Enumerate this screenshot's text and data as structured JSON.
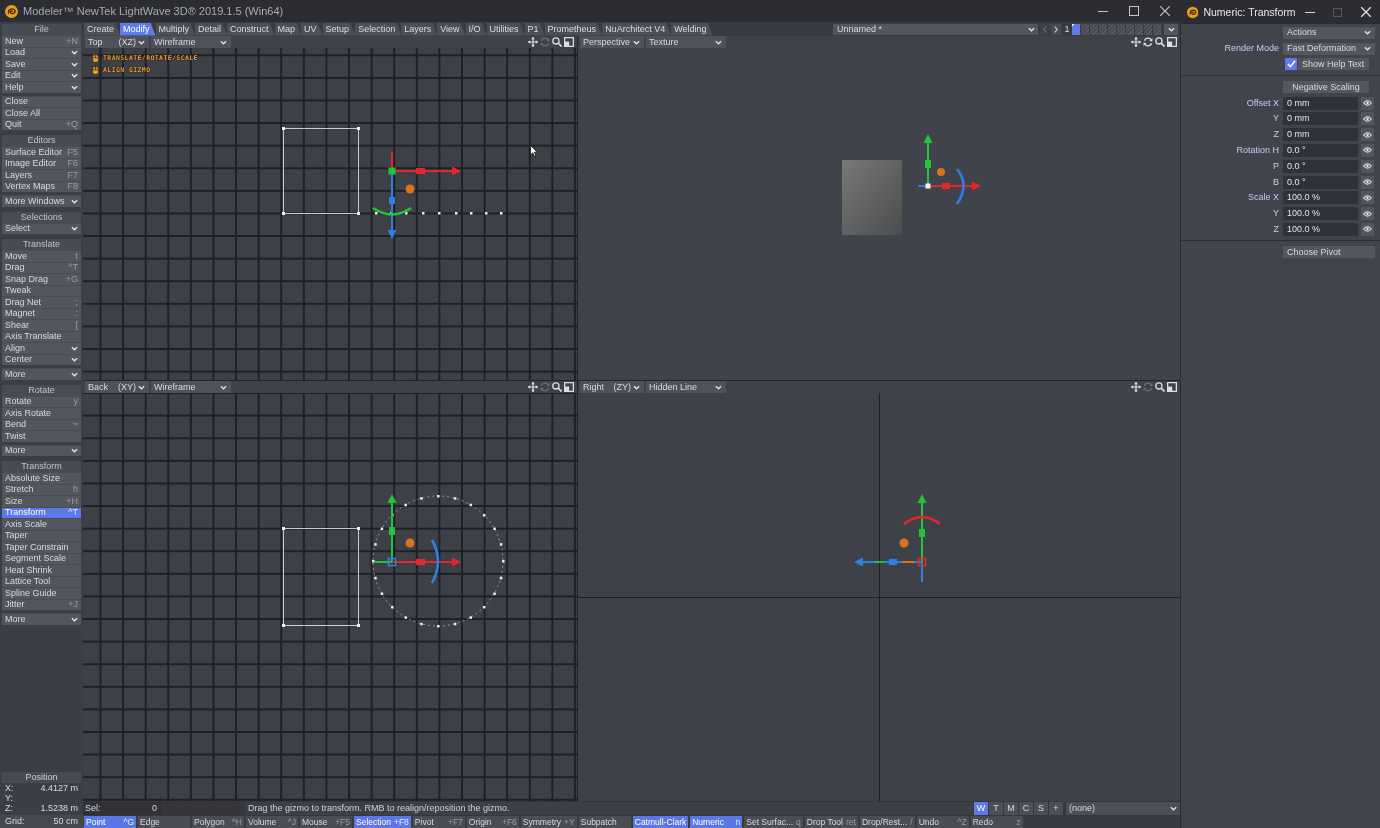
{
  "window": {
    "title": "Modeler™ NewTek LightWave 3D® 2019.1.5 (Win64)"
  },
  "sidebar": [
    {
      "title": "File",
      "items": [
        {
          "label": "New",
          "shortcut": "+N",
          "kind": "button",
          "selected": false
        },
        {
          "label": "Load",
          "kind": "menu",
          "selected": false
        },
        {
          "label": "Save",
          "kind": "menu",
          "selected": false
        },
        {
          "label": "Edit",
          "kind": "menu",
          "selected": false
        },
        {
          "label": "Help",
          "kind": "menu",
          "selected": false
        }
      ]
    },
    {
      "items": [
        {
          "label": "Close",
          "kind": "button",
          "selected": false
        },
        {
          "label": "Close All",
          "kind": "button",
          "selected": false
        },
        {
          "label": "Quit",
          "shortcut": "+Q",
          "kind": "button",
          "selected": false
        }
      ]
    },
    {
      "title": "Editors",
      "items": [
        {
          "label": "Surface Editor",
          "shortcut": "F5",
          "kind": "button",
          "selected": false
        },
        {
          "label": "Image Editor",
          "shortcut": "F6",
          "kind": "button",
          "selected": false
        },
        {
          "label": "Layers",
          "shortcut": "F7",
          "kind": "button",
          "selected": false
        },
        {
          "label": "Vertex Maps",
          "shortcut": "F8",
          "kind": "button",
          "selected": false
        }
      ]
    },
    {
      "items": [
        {
          "label": "More Windows",
          "kind": "menu",
          "selected": false
        }
      ]
    },
    {
      "title": "Selections",
      "items": [
        {
          "label": "Select",
          "kind": "menu",
          "selected": false
        }
      ]
    },
    {
      "title": "Translate",
      "items": [
        {
          "label": "Move",
          "shortcut": "t",
          "kind": "button",
          "selected": false
        },
        {
          "label": "Drag",
          "shortcut": "^T",
          "kind": "button",
          "selected": false
        },
        {
          "label": "Snap Drag",
          "shortcut": "+G",
          "kind": "button",
          "selected": false
        },
        {
          "label": "Tweak",
          "kind": "button",
          "selected": false
        },
        {
          "label": "Drag Net",
          "shortcut": ";",
          "kind": "button",
          "selected": false
        },
        {
          "label": "Magnet",
          "shortcut": ":",
          "kind": "button",
          "selected": false
        },
        {
          "label": "Shear",
          "shortcut": "[",
          "kind": "button",
          "selected": false
        },
        {
          "label": "Axis Translate",
          "kind": "button",
          "selected": false
        },
        {
          "label": "Align",
          "kind": "menu",
          "selected": false
        },
        {
          "label": "Center",
          "kind": "menu",
          "selected": false
        }
      ]
    },
    {
      "items": [
        {
          "label": "More",
          "kind": "menu",
          "selected": false
        }
      ]
    },
    {
      "title": "Rotate",
      "items": [
        {
          "label": "Rotate",
          "shortcut": "y",
          "kind": "button",
          "selected": false
        },
        {
          "label": "Axis Rotate",
          "kind": "button",
          "selected": false
        },
        {
          "label": "Bend",
          "shortcut": "~",
          "kind": "button",
          "selected": false
        },
        {
          "label": "Twist",
          "kind": "button",
          "selected": false
        }
      ]
    },
    {
      "items": [
        {
          "label": "More",
          "kind": "menu",
          "selected": false
        }
      ]
    },
    {
      "title": "Transform",
      "items": [
        {
          "label": "Absolute Size",
          "kind": "button",
          "selected": false
        },
        {
          "label": "Stretch",
          "shortcut": "h",
          "kind": "button",
          "selected": false
        },
        {
          "label": "Size",
          "shortcut": "+H",
          "kind": "button",
          "selected": false
        },
        {
          "label": "Transform",
          "shortcut": "^T",
          "kind": "button",
          "selected": true
        },
        {
          "label": "Axis Scale",
          "kind": "button",
          "selected": false
        },
        {
          "label": "Taper",
          "kind": "button",
          "selected": false
        },
        {
          "label": "Taper Constrain",
          "kind": "button",
          "selected": false
        },
        {
          "label": "Segment Scale",
          "kind": "button",
          "selected": false
        },
        {
          "label": "Heat Shrink",
          "kind": "button",
          "selected": false
        },
        {
          "label": "Lattice Tool",
          "kind": "button",
          "selected": false
        },
        {
          "label": "Spline Guide",
          "kind": "button",
          "selected": false
        },
        {
          "label": "Jitter",
          "shortcut": "+J",
          "kind": "button",
          "selected": false
        }
      ]
    },
    {
      "items": [
        {
          "label": "More",
          "kind": "menu",
          "selected": false
        }
      ]
    }
  ],
  "position": {
    "title": "Position",
    "rows": [
      {
        "axis": "X:",
        "value": "4.4127 m"
      },
      {
        "axis": "Y:"
      },
      {
        "axis": "Z:",
        "value": "1.5238 m"
      }
    ]
  },
  "grid": {
    "label": "Grid:",
    "value": "50 cm"
  },
  "tabs": [
    {
      "label": "Create",
      "selected": false
    },
    {
      "label": "Modify",
      "selected": true
    },
    {
      "label": "Multiply",
      "selected": false
    },
    {
      "label": "Detail",
      "selected": false
    },
    {
      "label": "Construct",
      "selected": false
    },
    {
      "label": "Map",
      "selected": false
    },
    {
      "label": "UV",
      "selected": false
    },
    {
      "label": "Setup",
      "selected": false
    },
    {
      "label": "Selection",
      "selected": false
    },
    {
      "label": "Layers",
      "selected": false
    },
    {
      "label": "View",
      "selected": false
    },
    {
      "label": "I/O",
      "selected": false
    },
    {
      "label": "Utilities",
      "selected": false
    },
    {
      "label": "P1",
      "selected": false
    },
    {
      "label": "Prometheus",
      "selected": false
    },
    {
      "label": "NuArchitect V4",
      "selected": false
    },
    {
      "label": "Welding",
      "selected": false
    }
  ],
  "scene": {
    "name": "Unnamed *",
    "bank": "1",
    "layers": [
      {
        "selected": true
      },
      {
        "selected": false
      },
      {
        "selected": false
      },
      {
        "selected": false
      },
      {
        "selected": false
      },
      {
        "selected": false
      },
      {
        "selected": false
      },
      {
        "selected": false
      },
      {
        "selected": false
      },
      {
        "selected": false
      }
    ]
  },
  "viewports": [
    {
      "kind": "top",
      "view": "Top",
      "axes": "(XZ)",
      "shading": "Wireframe",
      "rotate_enabled": false,
      "hints": [
        "TRANSLATE/ROTATE/SCALE",
        "ALIGN GIZMO"
      ]
    },
    {
      "kind": "perspective",
      "view": "Perspective",
      "shading": "Texture",
      "rotate_enabled": true
    },
    {
      "kind": "back",
      "view": "Back",
      "axes": "(XY)",
      "shading": "Wireframe",
      "rotate_enabled": false
    },
    {
      "kind": "right",
      "view": "Right",
      "axes": "(ZY)",
      "shading": "Hidden Line",
      "rotate_enabled": false
    }
  ],
  "status": {
    "sel_label": "Sel:",
    "sel_value": "0",
    "message": "Drag the gizmo to transform. RMB to realign/reposition the gizmo.",
    "modes": [
      {
        "label": "W",
        "selected": true
      },
      {
        "label": "T",
        "selected": false
      },
      {
        "label": "M",
        "selected": false
      },
      {
        "label": "C",
        "selected": false
      },
      {
        "label": "S",
        "selected": false
      },
      {
        "label": "+",
        "selected": false
      }
    ],
    "surface": "(none)"
  },
  "toolbar": [
    {
      "label": "Point",
      "shortcut": "^G",
      "selected": true
    },
    {
      "label": "Edge",
      "selected": false
    },
    {
      "label": "Polygon",
      "shortcut": "^H",
      "selected": false
    },
    {
      "label": "Volume",
      "shortcut": "^J",
      "selected": false
    },
    {
      "label": "Mouse",
      "shortcut": "+F5",
      "selected": false
    },
    {
      "label": "Selection",
      "shortcut": "+F8",
      "selected": true
    },
    {
      "label": "Pivot",
      "shortcut": "+F7",
      "selected": false
    },
    {
      "label": "Origin",
      "shortcut": "+F6",
      "selected": false
    },
    {
      "label": "Symmetry",
      "shortcut": "+Y",
      "selected": false
    },
    {
      "label": "Subpatch",
      "selected": false
    },
    {
      "label": "Catmull-Clark",
      "selected": true
    },
    {
      "label": "Numeric",
      "shortcut": "n",
      "selected": true
    },
    {
      "label": "Set Surfac...",
      "shortcut": "q",
      "selected": false
    },
    {
      "label": "Drop Tool",
      "shortcut": "ret",
      "selected": false
    },
    {
      "label": "Drop/Rest...",
      "shortcut": "/",
      "selected": false
    },
    {
      "label": "Undo",
      "shortcut": "^Z",
      "selected": false
    },
    {
      "label": "Redo",
      "shortcut": "z",
      "selected": false
    }
  ],
  "numeric": {
    "title": "Numeric: Transform",
    "actions": "Actions",
    "render_mode": {
      "label": "Render Mode",
      "value": "Fast Deformation"
    },
    "help_text": {
      "label": "Show Help Text",
      "checked": true
    },
    "negative_scaling": "Negative Scaling",
    "fields": [
      {
        "label": "Offset X",
        "value": "0 mm"
      },
      {
        "label": "Y",
        "value": "0 mm"
      },
      {
        "label": "Z",
        "value": "0 mm"
      },
      {
        "label": "Rotation H",
        "value": "0.0 °"
      },
      {
        "label": "P",
        "value": "0.0 °"
      },
      {
        "label": "B",
        "value": "0.0 °"
      },
      {
        "label": "Scale X",
        "value": "100.0 %"
      },
      {
        "label": "Y",
        "value": "100.0 %"
      },
      {
        "label": "Z",
        "value": "100.0 %"
      }
    ],
    "choose_pivot": "Choose Pivot"
  }
}
